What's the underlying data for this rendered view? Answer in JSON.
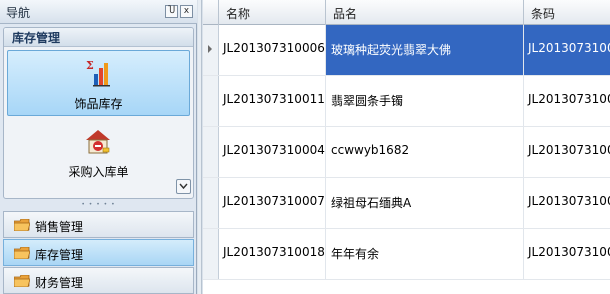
{
  "nav": {
    "title": "导航",
    "pin_glyph": "Ⴎ",
    "close_glyph": "x",
    "group_title": "库存管理",
    "tiles": [
      {
        "label": "饰品库存",
        "icon": "bar-chart-sigma-icon",
        "selected": true
      },
      {
        "label": "采购入库单",
        "icon": "house-purchase-icon",
        "selected": false
      }
    ],
    "categories": [
      {
        "label": "销售管理",
        "icon": "folder-icon",
        "active": false
      },
      {
        "label": "库存管理",
        "icon": "folder-icon",
        "active": true
      },
      {
        "label": "财务管理",
        "icon": "folder-icon",
        "active": false
      }
    ]
  },
  "grid": {
    "columns": [
      "名称",
      "品名",
      "条码"
    ],
    "rows": [
      {
        "name": "JL201307310006",
        "product": "玻璃种起荧光翡翠大佛",
        "barcode": "JL2013073100",
        "selected": true
      },
      {
        "name": "JL201307310011",
        "product": "翡翠圆条手镯",
        "barcode": "JL2013073100",
        "selected": false
      },
      {
        "name": "JL201307310004",
        "product": "ccwwyb1682",
        "barcode": "JL2013073100",
        "selected": false
      },
      {
        "name": "JL201307310007",
        "product": "绿祖母石缅典A",
        "barcode": "JL2013073100",
        "selected": false
      },
      {
        "name": "JL201307310018",
        "product": "年年有余",
        "barcode": "JL2013073100",
        "selected": false
      }
    ]
  },
  "colors": {
    "selection": "#3367c1",
    "tile_highlight": "#a7d6f7"
  }
}
